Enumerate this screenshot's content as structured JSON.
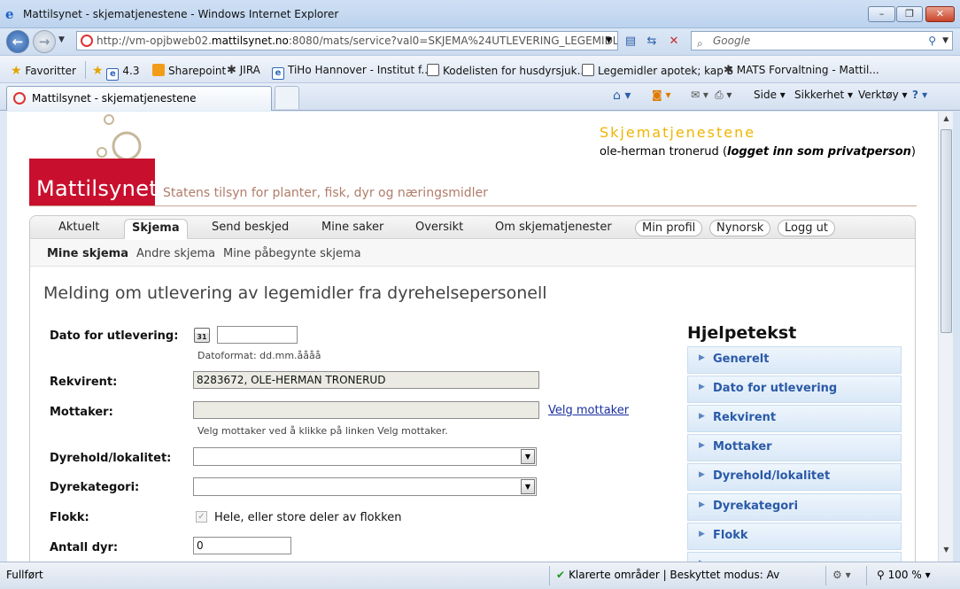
{
  "window": {
    "title": "Mattilsynet - skjematjenestene - Windows Internet Explorer",
    "min": "–",
    "max": "❐",
    "close": "✕"
  },
  "addressbar": {
    "url_prefix": "http://vm-opjbweb02.",
    "url_host": "mattilsynet.no",
    "url_rest": ":8080/mats/service?val0=SKJEMA%24UTLEVERING_LEGEMIDLER_FRADI",
    "search_placeholder": "Google"
  },
  "favorites": {
    "favorites_label": "Favoritter",
    "items": [
      "4.3",
      "Sharepoint",
      "JIRA",
      "TiHo Hannover - Institut f...",
      "Kodelisten for husdyrsjuk...",
      "Legemidler apotek; kap 5",
      "MATS Forvaltning - Mattil..."
    ]
  },
  "tab": {
    "label": "Mattilsynet - skjematjenestene"
  },
  "commandbar": {
    "page": "Side",
    "security": "Sikkerhet",
    "tools": "Verktøy"
  },
  "header": {
    "logo": "Mattilsynet",
    "tagline": "Statens tilsyn for planter, fisk, dyr og næringsmidler",
    "app_title": "Skjematjenestene",
    "user_name": "ole-herman tronerud",
    "user_note": "logget inn som privatperson",
    "paren_open": "(",
    "paren_close": ")"
  },
  "menu": {
    "items": [
      "Aktuelt",
      "Skjema",
      "Send beskjed",
      "Mine saker",
      "Oversikt",
      "Om skjematjenester"
    ],
    "pills": [
      "Min profil",
      "Nynorsk",
      "Logg ut"
    ],
    "active": "Skjema"
  },
  "submenu": {
    "items": [
      "Mine skjema",
      "Andre skjema",
      "Mine påbegynte skjema"
    ],
    "active": "Mine skjema"
  },
  "form": {
    "title": "Melding om utlevering av legemidler fra dyrehelsepersonell",
    "dato_label": "Dato for utlevering:",
    "dato_value": "",
    "calendar_text": "31",
    "dato_hint": "Datoformat: dd.mm.åååå",
    "rekvirent_label": "Rekvirent:",
    "rekvirent_value": "8283672, OLE-HERMAN TRONERUD",
    "mottaker_label": "Mottaker:",
    "mottaker_value": "",
    "mottaker_link": "Velg mottaker",
    "mottaker_hint": "Velg mottaker ved å klikke på linken Velg mottaker.",
    "dyrehold_label": "Dyrehold/lokalitet:",
    "dyrehold_value": "",
    "dyrekategori_label": "Dyrekategori:",
    "dyrekategori_value": "",
    "flokk_label": "Flokk:",
    "flokk_checkbox_label": "Hele, eller store deler av flokken",
    "flokk_checked": true,
    "antall_label": "Antall dyr:",
    "antall_value": "0"
  },
  "help": {
    "title": "Hjelpetekst",
    "items": [
      "Generelt",
      "Dato for utlevering",
      "Rekvirent",
      "Mottaker",
      "Dyrehold/lokalitet",
      "Dyrekategori",
      "Flokk"
    ]
  },
  "statusbar": {
    "status": "Fullført",
    "zone": "Klarerte områder | Beskyttet modus: Av",
    "zoom": "100 %"
  }
}
